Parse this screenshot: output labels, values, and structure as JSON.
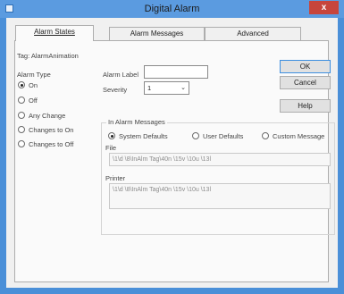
{
  "window": {
    "title": "Digital Alarm",
    "close_label": "x"
  },
  "tabs": [
    {
      "label": "Alarm States",
      "active": true
    },
    {
      "label": "Alarm Messages",
      "active": false
    },
    {
      "label": "Advanced",
      "active": false
    }
  ],
  "tag": {
    "text": "Tag: AlarmAnimation"
  },
  "alarm_type": {
    "label": "Alarm Type",
    "options": [
      {
        "label": "On",
        "checked": true
      },
      {
        "label": "Off",
        "checked": false
      },
      {
        "label": "Any Change",
        "checked": false
      },
      {
        "label": "Changes to On",
        "checked": false
      },
      {
        "label": "Changes to Off",
        "checked": false
      }
    ]
  },
  "alarm_label": {
    "label": "Alarm Label",
    "value": ""
  },
  "severity": {
    "label": "Severity",
    "value": "1"
  },
  "buttons": {
    "ok": "OK",
    "cancel": "Cancel",
    "help": "Help"
  },
  "messages": {
    "group_label": "In Alarm Messages",
    "options": [
      {
        "label": "System Defaults",
        "checked": true
      },
      {
        "label": "User Defaults",
        "checked": false
      },
      {
        "label": "Custom Message",
        "checked": false
      }
    ],
    "file_label": "File",
    "file_value": "\\1\\d \\8\\InAlm Tag\\40n \\15v \\10u \\13l",
    "printer_label": "Printer",
    "printer_value": "\\1\\d \\8\\InAlm Tag\\40n \\15v \\10u \\13l"
  },
  "colors": {
    "titlebar": "#5b9be0",
    "border": "#4a8fd8",
    "close": "#c7453c",
    "dialog_bg": "#f0f0f0"
  }
}
